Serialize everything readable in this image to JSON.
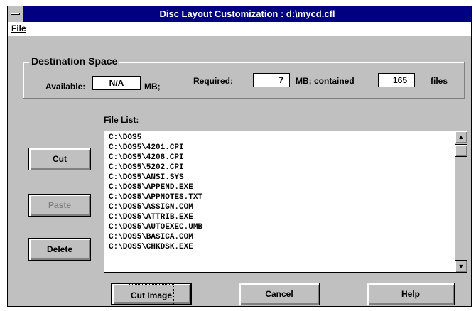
{
  "window": {
    "title": "Disc Layout Customization : d:\\mycd.cfl"
  },
  "menubar": {
    "file_label": "File"
  },
  "destination": {
    "group_title": "Destination Space",
    "available_label": "Available:",
    "available_value": "N/A",
    "available_unit": "MB;",
    "required_label": "Required:",
    "required_value": "7",
    "contained_label": "MB; contained",
    "contained_value": "165",
    "files_label": "files"
  },
  "file_list": {
    "label": "File List:",
    "items": [
      "C:\\DOS5",
      "C:\\DOS5\\4201.CPI",
      "C:\\DOS5\\4208.CPI",
      "C:\\DOS5\\5202.CPI",
      "C:\\DOS5\\ANSI.SYS",
      "C:\\DOS5\\APPEND.EXE",
      "C:\\DOS5\\APPNOTES.TXT",
      "C:\\DOS5\\ASSIGN.COM",
      "C:\\DOS5\\ATTRIB.EXE",
      "C:\\DOS5\\AUTOEXEC.UMB",
      "C:\\DOS5\\BASICA.COM",
      "C:\\DOS5\\CHKDSK.EXE"
    ]
  },
  "buttons": {
    "cut": "Cut",
    "paste": "Paste",
    "delete": "Delete",
    "cut_image": "Cut Image",
    "cancel": "Cancel",
    "help": "Help"
  },
  "colors": {
    "titlebar": "#000080",
    "face": "#c0c0c0",
    "disabled_text": "#808080"
  }
}
